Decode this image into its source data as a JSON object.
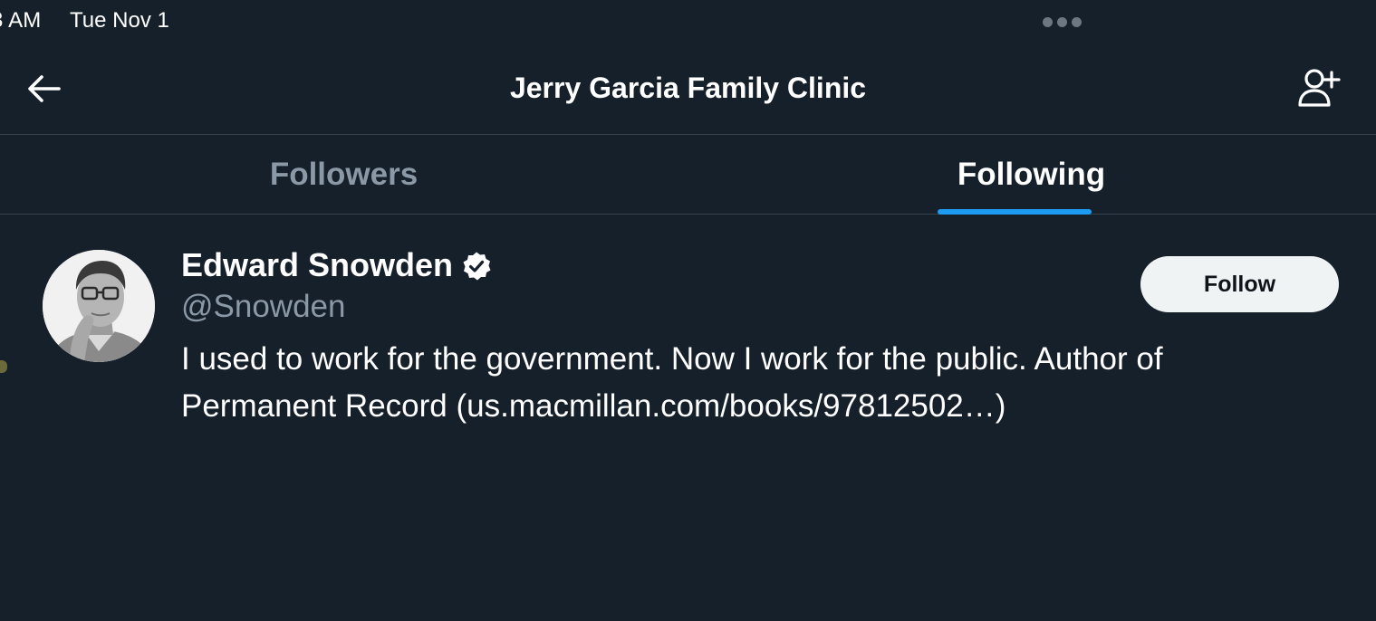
{
  "status_bar": {
    "time": "3 AM",
    "date": "Tue Nov 1"
  },
  "header": {
    "title": "Jerry Garcia Family Clinic",
    "back_icon": "arrow-left-icon",
    "add_user_icon": "add-user-icon"
  },
  "tabs": [
    {
      "label": "Followers",
      "active": false
    },
    {
      "label": "Following",
      "active": true
    }
  ],
  "users": [
    {
      "display_name": "Edward Snowden",
      "verified": true,
      "handle": "@Snowden",
      "bio": "I used to work for the government. Now I work for the public. Author of Permanent Record (us.macmillan.com/books/97812502…)",
      "follow_label": "Follow"
    }
  ],
  "colors": {
    "background": "#15202b",
    "accent": "#1d9bf0",
    "secondary_text": "#8b98a5",
    "divider": "#38444d",
    "button_bg": "#eff3f4"
  }
}
